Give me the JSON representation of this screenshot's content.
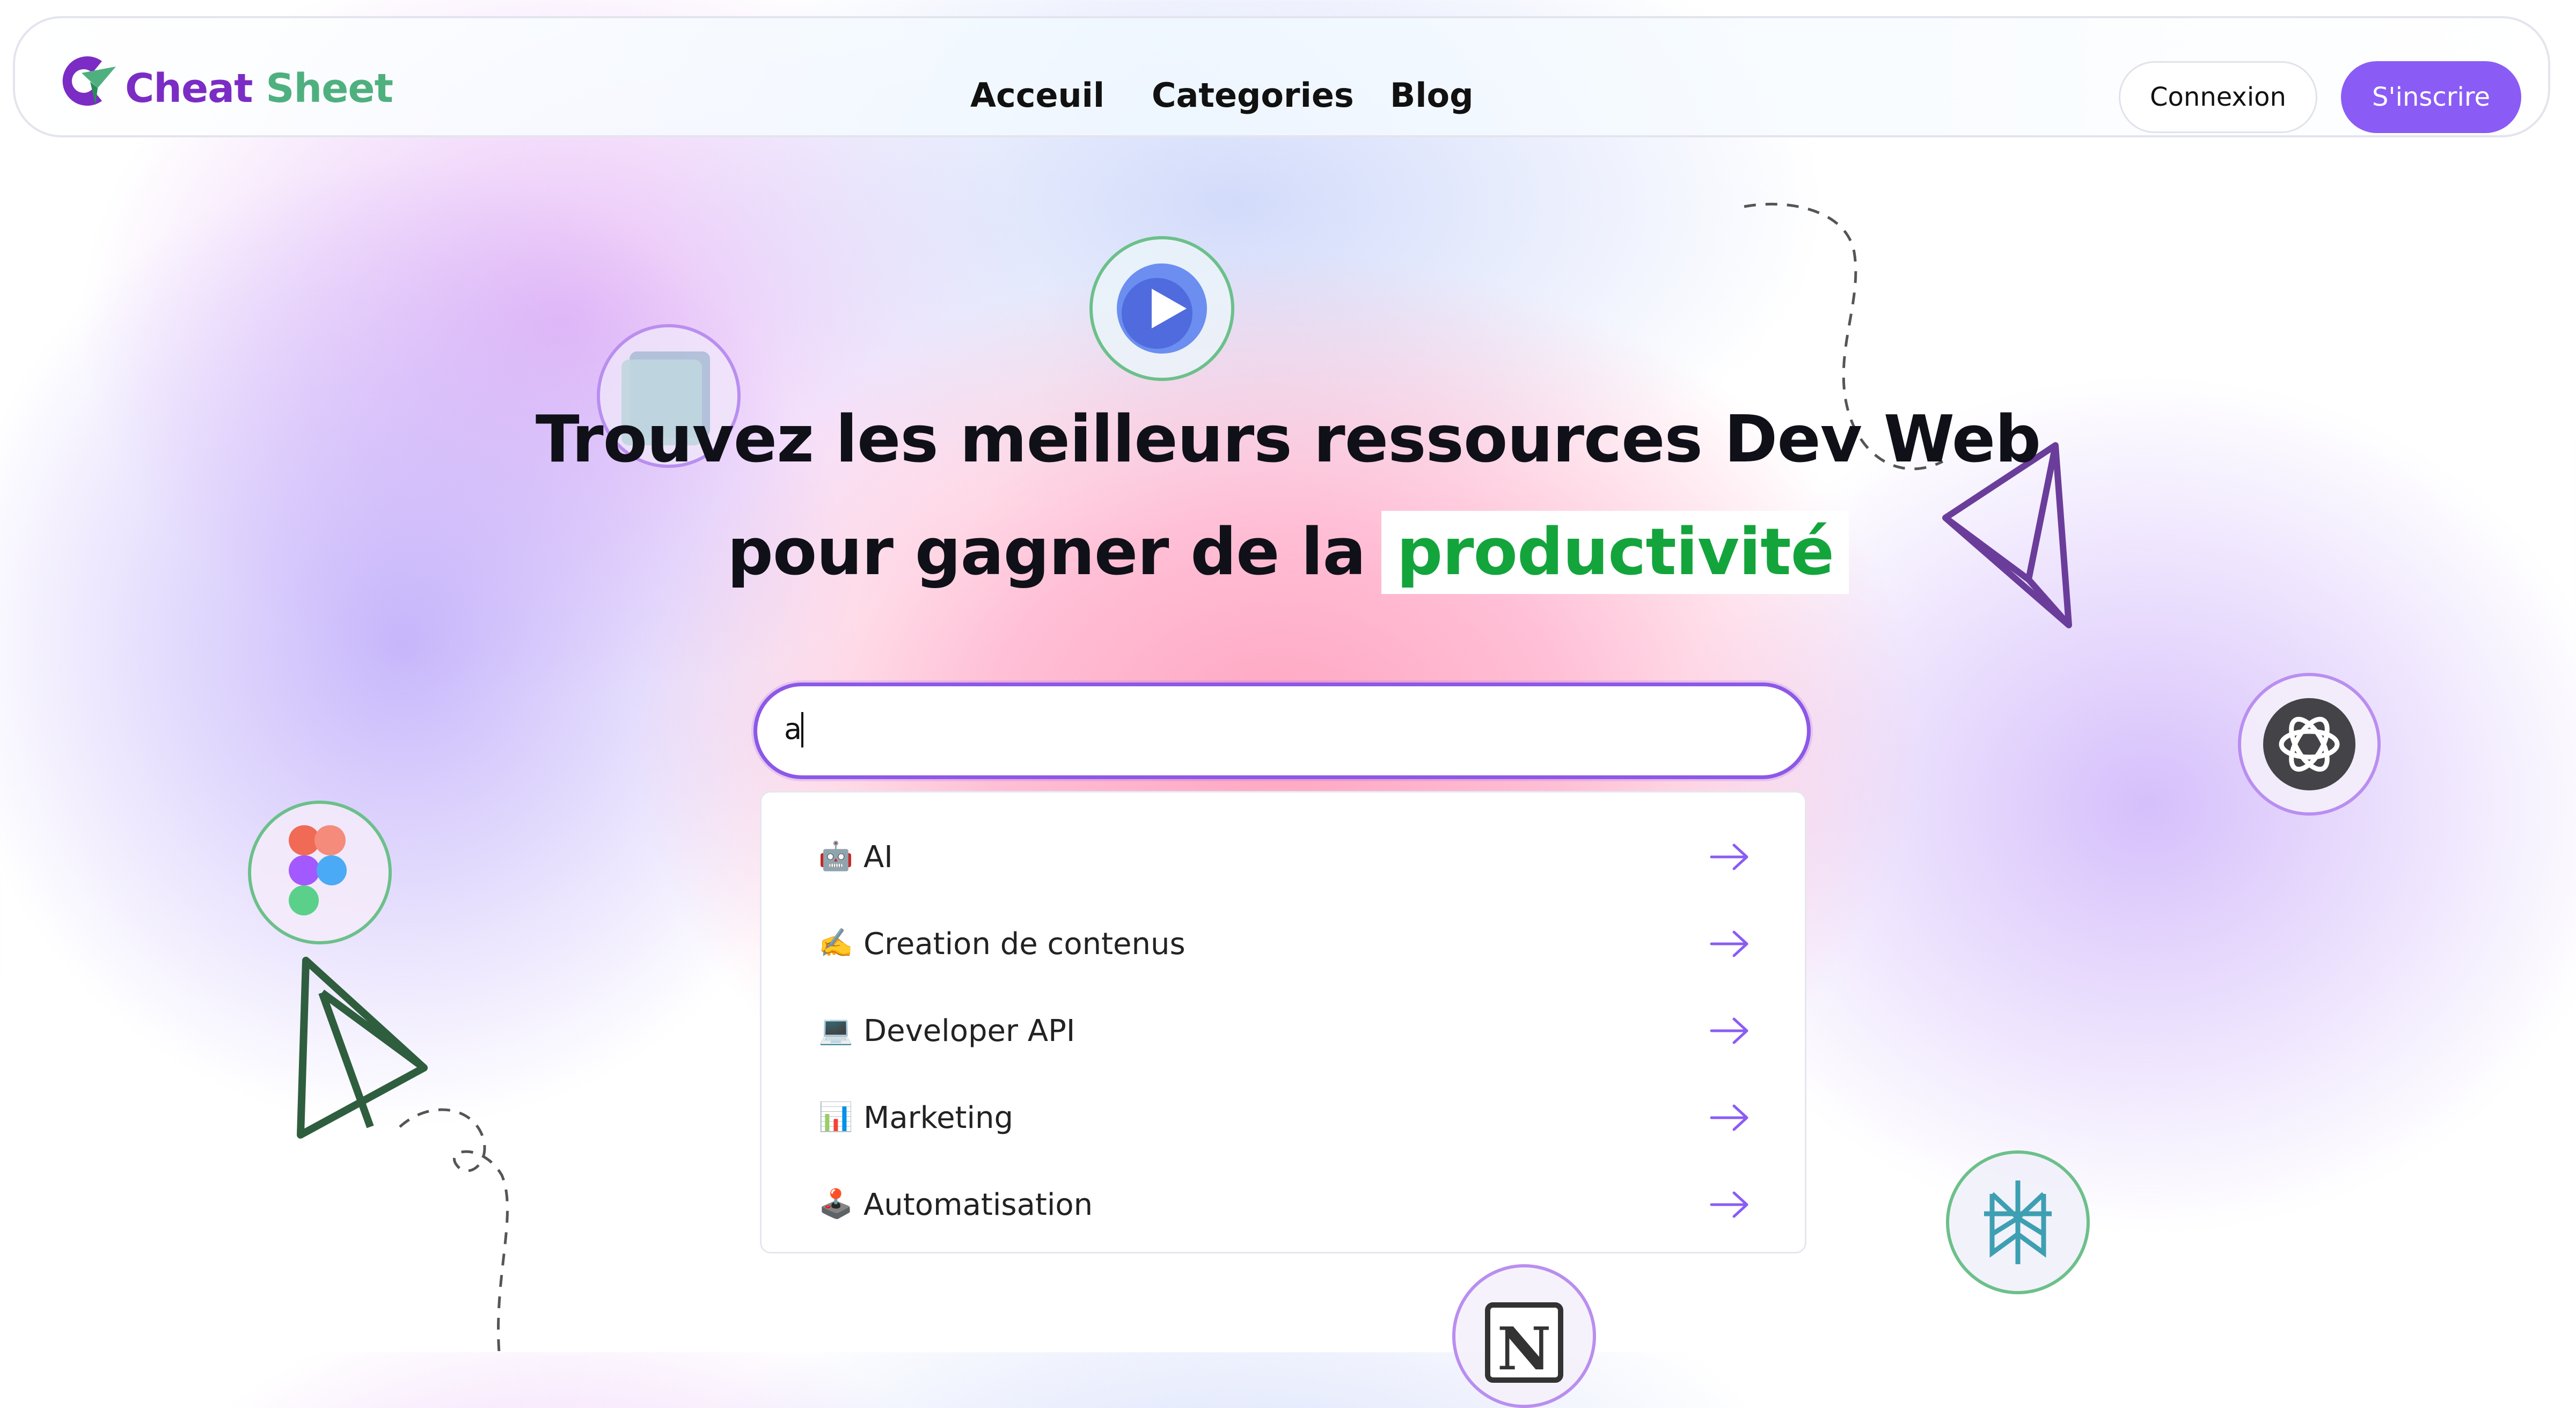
{
  "header": {
    "logo_part1": "Cheat",
    "logo_part2": "Sheet",
    "nav": [
      "Acceuil",
      "Categories",
      "Blog"
    ],
    "login_label": "Connexion",
    "signup_label": "S'inscrire"
  },
  "hero": {
    "line1": "Trouvez les meilleurs ressources Dev Web",
    "line2_prefix": "pour gagner de la",
    "line2_highlight": "productivité"
  },
  "search": {
    "value": "a"
  },
  "dropdown": {
    "items": [
      {
        "emoji": "🤖",
        "label": "AI"
      },
      {
        "emoji": "✍️",
        "label": "Creation de contenus"
      },
      {
        "emoji": "💻",
        "label": "Developer API"
      },
      {
        "emoji": "📊",
        "label": "Marketing"
      },
      {
        "emoji": "🕹️",
        "label": "Automatisation"
      }
    ]
  },
  "colors": {
    "brand_purple": "#8a5cf5",
    "logo_purple": "#7b2cc4",
    "logo_green": "#4fb07f",
    "highlight_green": "#14a43c"
  },
  "icons": [
    "play-app-icon",
    "glass-square-icon",
    "openai-icon",
    "figma-icon",
    "perplexity-icon",
    "notion-icon"
  ]
}
